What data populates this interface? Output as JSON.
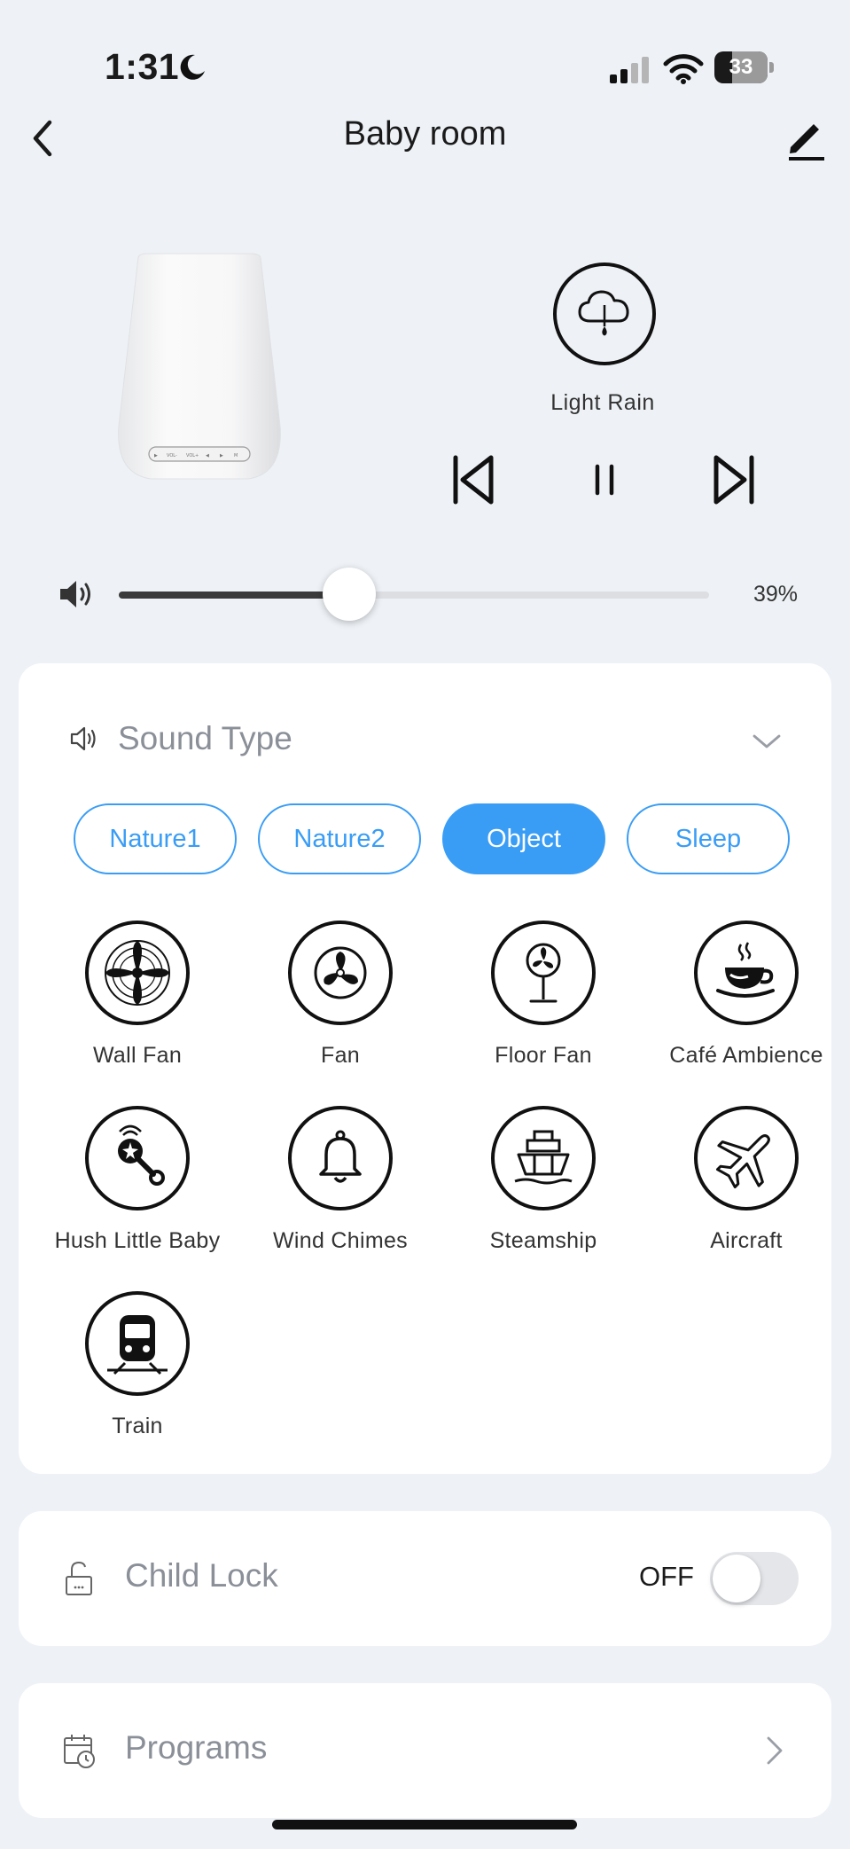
{
  "status_bar": {
    "time": "1:31",
    "battery_level": "33",
    "battery_fraction": 0.33,
    "icons": [
      "moon-icon",
      "cellular-signal-icon",
      "wifi-icon",
      "battery-icon"
    ]
  },
  "header": {
    "title": "Baby room",
    "back_icon": "chevron-left-icon",
    "edit_icon": "pencil-icon"
  },
  "player": {
    "current_sound": "Light Rain",
    "current_sound_icon": "cloud-rain-icon",
    "controls": [
      "previous-track-icon",
      "pause-icon",
      "next-track-icon"
    ]
  },
  "volume": {
    "value_text": "39%",
    "level": 0.39
  },
  "sound_type": {
    "label": "Sound Type",
    "tabs": [
      {
        "label": "Nature1",
        "active": false
      },
      {
        "label": "Nature2",
        "active": false
      },
      {
        "label": "Object",
        "active": true
      },
      {
        "label": "Sleep",
        "active": false
      }
    ],
    "sounds": [
      {
        "label": "Wall Fan",
        "icon": "wall-fan-icon"
      },
      {
        "label": "Fan",
        "icon": "fan-icon"
      },
      {
        "label": "Floor Fan",
        "icon": "floor-fan-icon"
      },
      {
        "label": "Café Ambience",
        "icon": "coffee-cup-icon"
      },
      {
        "label": "Hush Little Baby",
        "icon": "rattle-icon"
      },
      {
        "label": "Wind Chimes",
        "icon": "bell-icon"
      },
      {
        "label": "Steamship",
        "icon": "ship-icon"
      },
      {
        "label": "Aircraft",
        "icon": "airplane-icon"
      },
      {
        "label": "Train",
        "icon": "train-icon"
      }
    ]
  },
  "child_lock": {
    "label": "Child Lock",
    "state": "OFF",
    "on": false
  },
  "programs": {
    "label": "Programs"
  },
  "colors": {
    "accent": "#3a9df5",
    "background": "#eef2f6",
    "muted_text": "#8a8f98"
  }
}
